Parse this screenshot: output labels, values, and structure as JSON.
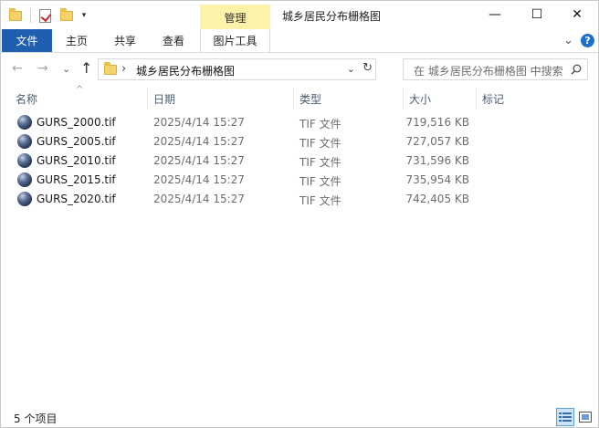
{
  "titlebar": {
    "title": "城乡居民分布栅格图",
    "context_tab": "管理",
    "minimize": "—",
    "maximize": "☐",
    "close": "✕",
    "quick_access_dropdown": "▾"
  },
  "ribbon": {
    "tabs": [
      {
        "label": "文件"
      },
      {
        "label": "主页"
      },
      {
        "label": "共享"
      },
      {
        "label": "查看"
      },
      {
        "label": "图片工具"
      }
    ],
    "expand_glyph": "⌄",
    "help_glyph": "?"
  },
  "nav": {
    "back": "←",
    "forward": "→",
    "recent": "⌄",
    "up": "↑"
  },
  "address": {
    "separator": "›",
    "path": "城乡居民分布栅格图",
    "dropdown": "⌄",
    "refresh": "↻"
  },
  "search": {
    "placeholder": "在 城乡居民分布栅格图 中搜索"
  },
  "columns": {
    "name": "名称",
    "date": "日期",
    "type": "类型",
    "size": "大小",
    "tags": "标记",
    "sort_caret": "^"
  },
  "files": [
    {
      "name": "GURS_2000.tif",
      "date": "2025/4/14 15:27",
      "type": "TIF 文件",
      "size": "719,516 KB"
    },
    {
      "name": "GURS_2005.tif",
      "date": "2025/4/14 15:27",
      "type": "TIF 文件",
      "size": "727,057 KB"
    },
    {
      "name": "GURS_2010.tif",
      "date": "2025/4/14 15:27",
      "type": "TIF 文件",
      "size": "731,596 KB"
    },
    {
      "name": "GURS_2015.tif",
      "date": "2025/4/14 15:27",
      "type": "TIF 文件",
      "size": "735,954 KB"
    },
    {
      "name": "GURS_2020.tif",
      "date": "2025/4/14 15:27",
      "type": "TIF 文件",
      "size": "742,405 KB"
    }
  ],
  "status": {
    "item_count": "5 个项目"
  },
  "icons": {
    "file": "globe-icon",
    "folder": "folder-icon"
  },
  "colors": {
    "file_tab": "#1f5fb0",
    "context_tab": "#fcf3a8",
    "header_text": "#4a5b73"
  }
}
